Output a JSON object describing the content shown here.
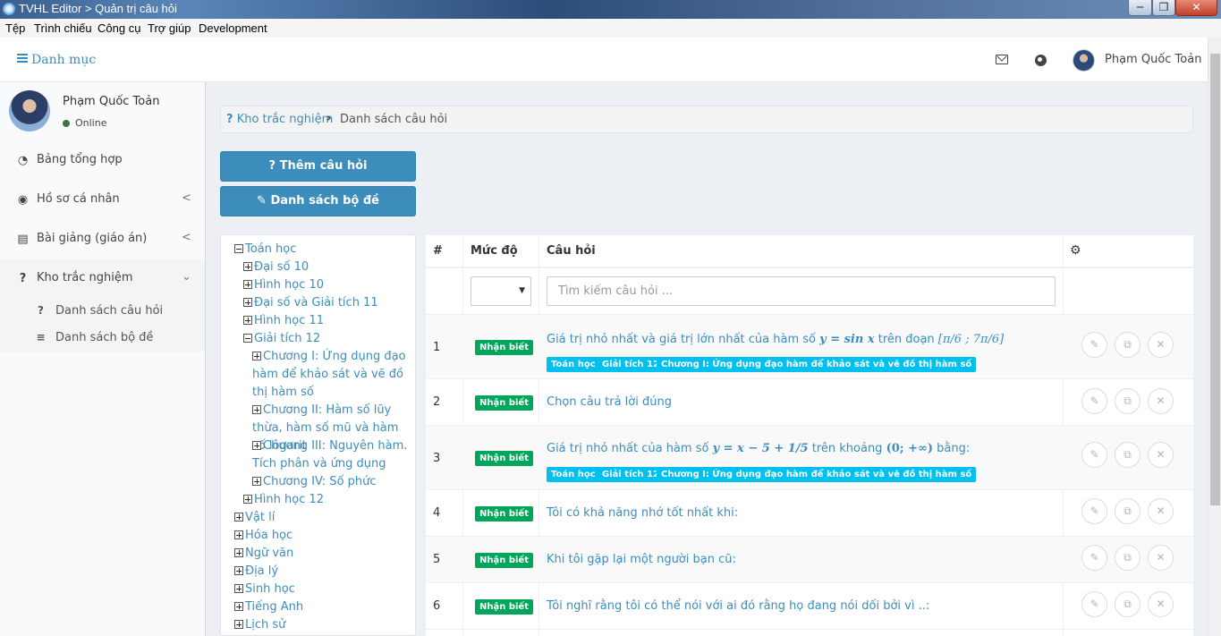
{
  "window": {
    "title": "TVHL Editor > Quản trị câu hỏi",
    "min_glyph": "─",
    "max_glyph": "❐",
    "close_glyph": "✕"
  },
  "menubar": [
    "Tệp",
    "Trình chiếu",
    "Công cụ",
    "Trợ giúp",
    "Development"
  ],
  "topnav": {
    "toggle_label": "Danh mục",
    "user_name": "Phạm Quốc Toản"
  },
  "sidebar": {
    "user_name": "Phạm Quốc Toản",
    "status": "Online",
    "items": [
      {
        "label": "Bảng tổng hợp",
        "icon": "dashboard-icon",
        "glyph": "◔"
      },
      {
        "label": "Hồ sơ cá nhân",
        "icon": "user-circle-icon",
        "glyph": "◉",
        "chevron": "<"
      },
      {
        "label": "Bài giảng (giáo án)",
        "icon": "newspaper-icon",
        "glyph": "▤",
        "chevron": "<"
      },
      {
        "label": "Kho trắc nghiệm",
        "icon": "question-circle-icon",
        "glyph": "?",
        "chevron": "⌄"
      }
    ],
    "subitems": [
      {
        "label": "Danh sách câu hỏi",
        "icon": "question-circle-icon",
        "glyph": "?"
      },
      {
        "label": "Danh sách bộ đề",
        "icon": "database-icon",
        "glyph": "≡"
      }
    ]
  },
  "breadcrumb": {
    "home": "Kho trắc nghiệm",
    "separator": "›",
    "current": "Danh sách câu hỏi"
  },
  "buttons": {
    "add_question": "Thêm câu hỏi",
    "exam_list": "Danh sách bộ đề"
  },
  "tree": [
    {
      "label": "Toán học",
      "state": "minus"
    },
    {
      "label": "Đại số 10",
      "state": "plus"
    },
    {
      "label": "Hình học 10",
      "state": "plus"
    },
    {
      "label": "Đại số và Giải tích 11",
      "state": "plus"
    },
    {
      "label": "Hình học 11",
      "state": "plus"
    },
    {
      "label": "Giải tích 12",
      "state": "minus"
    },
    {
      "label": "Chương I: Ứng dụng đạo hàm để khảo sát và vẽ đồ thị hàm số",
      "state": "plus"
    },
    {
      "label": "Chương II: Hàm số lũy thừa, hàm số mũ và hàm số lôgarit",
      "state": "plus"
    },
    {
      "label": "Chương III: Nguyên hàm. Tích phân và ứng dụng",
      "state": "plus"
    },
    {
      "label": "Chương IV: Số phức",
      "state": "plus"
    },
    {
      "label": "Hình học 12",
      "state": "plus"
    },
    {
      "label": "Vật lí",
      "state": "plus"
    },
    {
      "label": "Hóa học",
      "state": "plus"
    },
    {
      "label": "Ngữ văn",
      "state": "plus"
    },
    {
      "label": "Địa lý",
      "state": "plus"
    },
    {
      "label": "Sinh học",
      "state": "plus"
    },
    {
      "label": "Tiếng Anh",
      "state": "plus"
    },
    {
      "label": "Lịch sử",
      "state": "plus"
    }
  ],
  "table": {
    "headers": [
      "#",
      "Mức độ",
      "Câu hỏi",
      "⚙"
    ],
    "search_placeholder": "Tìm kiếm câu hỏi ...",
    "level_select_value": "",
    "rows": [
      {
        "num": "1",
        "level": "Nhận biết",
        "q_prefix": "Giá trị nhỏ nhất và giá trị lớn nhất của hàm số ",
        "q_math": "y = sin x",
        "q_suffix": " trên đoạn ",
        "q_math2": "[π/6 ; 7π/6]",
        "tags": [
          "Toán học",
          "Giải tích 12",
          "Chương I: Ứng dụng đạo hàm để khảo sát và vẽ đồ thị hàm số"
        ]
      },
      {
        "num": "2",
        "level": "Nhận biết",
        "q_prefix": "Chọn câu  trả lời đúng",
        "tags": []
      },
      {
        "num": "3",
        "level": "Nhận biết",
        "q_prefix": "Giá trị nhỏ nhất của hàm số ",
        "q_math": "y = x − 5 + 1/5",
        "q_suffix": " trên khoảng ",
        "q_math2": "(0; +∞)",
        "q_suffix2": " bằng:",
        "tags": [
          "Toán học",
          "Giải tích 12",
          "Chương I: Ứng dụng đạo hàm để khảo sát và vẽ đồ thị hàm số"
        ]
      },
      {
        "num": "4",
        "level": "Nhận biết",
        "q_prefix": "Tôi có khả năng nhớ tốt nhất khi:",
        "tags": []
      },
      {
        "num": "5",
        "level": "Nhận biết",
        "q_prefix": "Khi tôi gặp lại một người bạn cũ:",
        "tags": []
      },
      {
        "num": "6",
        "level": "Nhận biết",
        "q_prefix": "Tôi nghĩ rằng tôi có thể nói với ai đó rằng họ đang nói dối bởi vì ..:",
        "tags": []
      }
    ],
    "actions": {
      "edit": "✎",
      "copy": "⧉",
      "delete": "✕"
    }
  },
  "colors": {
    "primary": "#3c8dbc",
    "success_badge": "#00a65a",
    "info_tag": "#00c0ef"
  }
}
